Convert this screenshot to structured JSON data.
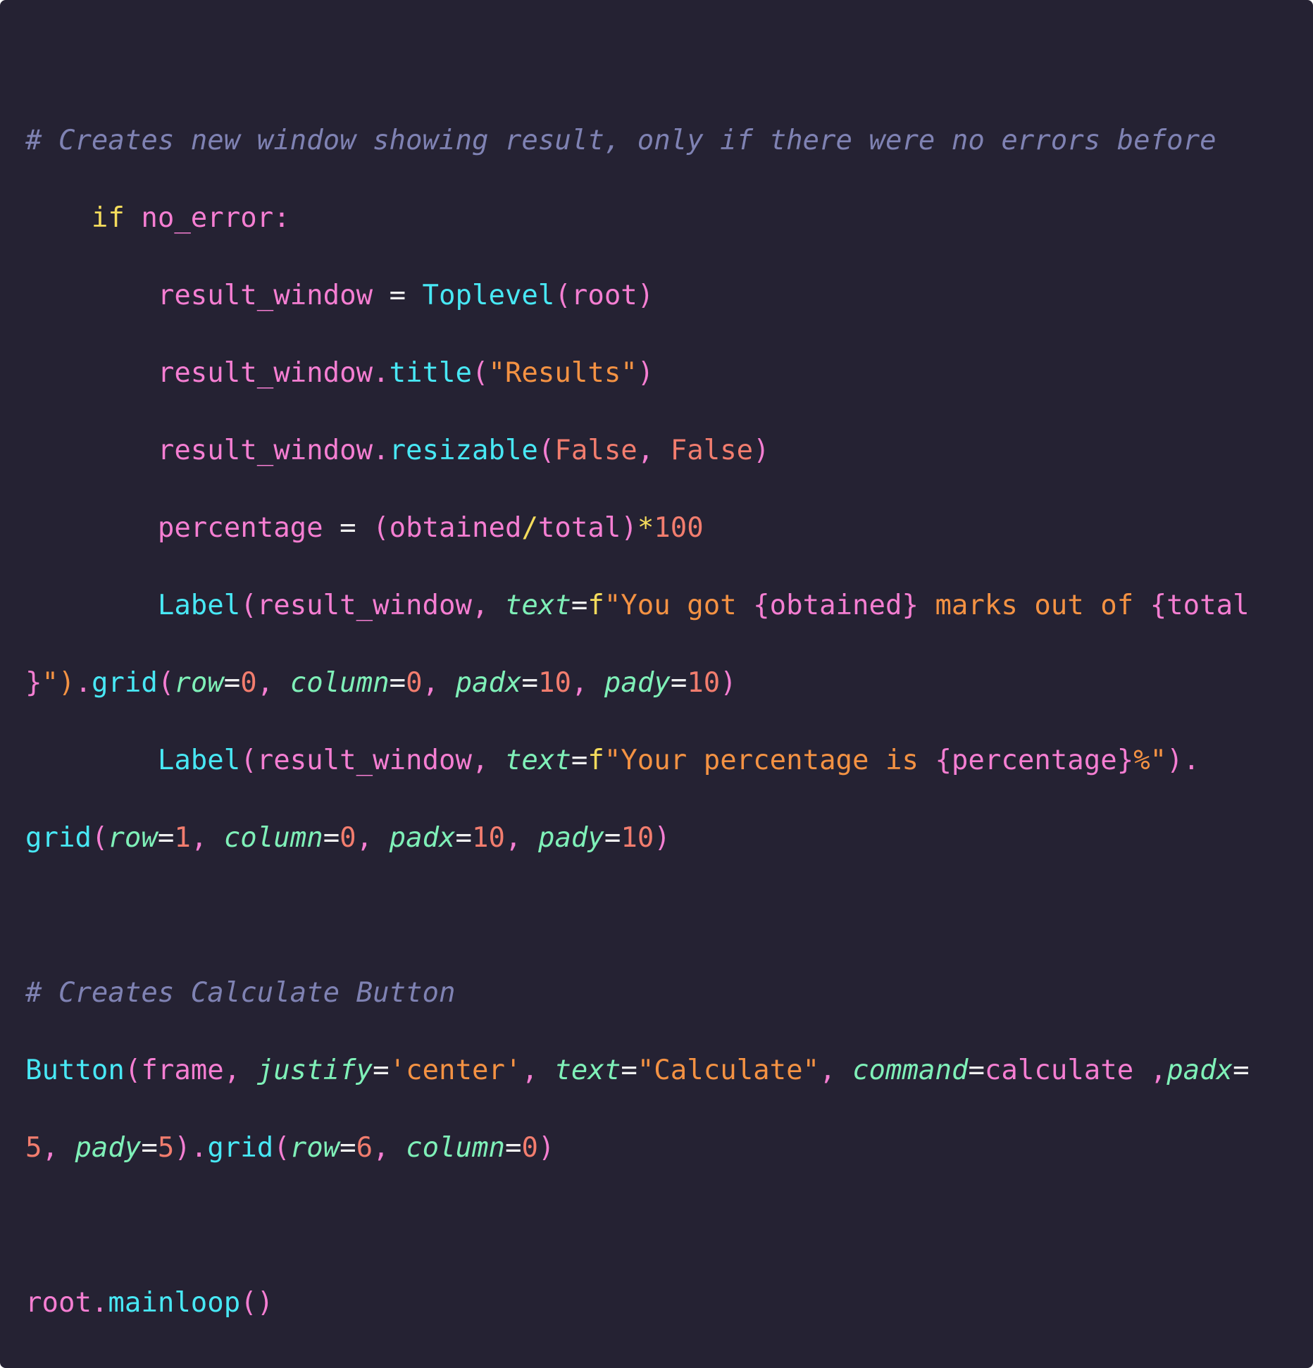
{
  "theme": {
    "background": "#252233",
    "colors": {
      "comment": "#7f82b3",
      "keyword": "#f5dc5c",
      "variable": "#f57ed2",
      "function": "#48e8f5",
      "string": "#f49243",
      "number": "#f27d6e",
      "param": "#7ff0b8",
      "operator": "#f0f0f0",
      "punct": "#f57ed2",
      "fstring_prefix": "#f5dc5c"
    }
  },
  "code_lines": [
    [
      {
        "t": "# Creates new window showing result, only if there were no errors before",
        "c": "comment",
        "i": true
      }
    ],
    [
      {
        "t": "    "
      },
      {
        "t": "if",
        "c": "keyword"
      },
      {
        "t": " no_error:",
        "c": "variable"
      }
    ],
    [
      {
        "t": "        "
      },
      {
        "t": "result_window",
        "c": "variable"
      },
      {
        "t": " = ",
        "c": "operator"
      },
      {
        "t": "Toplevel",
        "c": "function"
      },
      {
        "t": "(root)",
        "c": "variable"
      }
    ],
    [
      {
        "t": "        "
      },
      {
        "t": "result_window.",
        "c": "variable"
      },
      {
        "t": "title",
        "c": "function"
      },
      {
        "t": "(",
        "c": "punct"
      },
      {
        "t": "\"Results\"",
        "c": "string"
      },
      {
        "t": ")",
        "c": "punct"
      }
    ],
    [
      {
        "t": "        "
      },
      {
        "t": "result_window.",
        "c": "variable"
      },
      {
        "t": "resizable",
        "c": "function"
      },
      {
        "t": "(",
        "c": "punct"
      },
      {
        "t": "False",
        "c": "number"
      },
      {
        "t": ", ",
        "c": "punct"
      },
      {
        "t": "False",
        "c": "number"
      },
      {
        "t": ")",
        "c": "punct"
      }
    ],
    [
      {
        "t": "        "
      },
      {
        "t": "percentage",
        "c": "variable"
      },
      {
        "t": " = ",
        "c": "operator"
      },
      {
        "t": "(obtained",
        "c": "variable"
      },
      {
        "t": "/",
        "c": "keyword"
      },
      {
        "t": "total)",
        "c": "variable"
      },
      {
        "t": "*",
        "c": "keyword"
      },
      {
        "t": "100",
        "c": "number"
      }
    ],
    [
      {
        "t": "        "
      },
      {
        "t": "Label",
        "c": "function"
      },
      {
        "t": "(result_window, ",
        "c": "variable"
      },
      {
        "t": "text",
        "c": "param",
        "i": true
      },
      {
        "t": "=",
        "c": "operator"
      },
      {
        "t": "f",
        "c": "fstring_prefix"
      },
      {
        "t": "\"You got ",
        "c": "string"
      },
      {
        "t": "{obtained}",
        "c": "variable"
      },
      {
        "t": " marks out of ",
        "c": "string"
      },
      {
        "t": "{total",
        "c": "variable"
      }
    ],
    [
      {
        "t": "}",
        "c": "variable"
      },
      {
        "t": "\")",
        "c": "string"
      },
      {
        "t": ".",
        "c": "punct"
      },
      {
        "t": "grid",
        "c": "function"
      },
      {
        "t": "(",
        "c": "punct"
      },
      {
        "t": "row",
        "c": "param",
        "i": true
      },
      {
        "t": "=",
        "c": "operator"
      },
      {
        "t": "0",
        "c": "number"
      },
      {
        "t": ", ",
        "c": "punct"
      },
      {
        "t": "column",
        "c": "param",
        "i": true
      },
      {
        "t": "=",
        "c": "operator"
      },
      {
        "t": "0",
        "c": "number"
      },
      {
        "t": ", ",
        "c": "punct"
      },
      {
        "t": "padx",
        "c": "param",
        "i": true
      },
      {
        "t": "=",
        "c": "operator"
      },
      {
        "t": "10",
        "c": "number"
      },
      {
        "t": ", ",
        "c": "punct"
      },
      {
        "t": "pady",
        "c": "param",
        "i": true
      },
      {
        "t": "=",
        "c": "operator"
      },
      {
        "t": "10",
        "c": "number"
      },
      {
        "t": ")",
        "c": "punct"
      }
    ],
    [
      {
        "t": "        "
      },
      {
        "t": "Label",
        "c": "function"
      },
      {
        "t": "(result_window, ",
        "c": "variable"
      },
      {
        "t": "text",
        "c": "param",
        "i": true
      },
      {
        "t": "=",
        "c": "operator"
      },
      {
        "t": "f",
        "c": "fstring_prefix"
      },
      {
        "t": "\"Your percentage is ",
        "c": "string"
      },
      {
        "t": "{percentage}",
        "c": "variable"
      },
      {
        "t": "%\"",
        "c": "string"
      },
      {
        "t": ").",
        "c": "punct"
      }
    ],
    [
      {
        "t": "grid",
        "c": "function"
      },
      {
        "t": "(",
        "c": "punct"
      },
      {
        "t": "row",
        "c": "param",
        "i": true
      },
      {
        "t": "=",
        "c": "operator"
      },
      {
        "t": "1",
        "c": "number"
      },
      {
        "t": ", ",
        "c": "punct"
      },
      {
        "t": "column",
        "c": "param",
        "i": true
      },
      {
        "t": "=",
        "c": "operator"
      },
      {
        "t": "0",
        "c": "number"
      },
      {
        "t": ", ",
        "c": "punct"
      },
      {
        "t": "padx",
        "c": "param",
        "i": true
      },
      {
        "t": "=",
        "c": "operator"
      },
      {
        "t": "10",
        "c": "number"
      },
      {
        "t": ", ",
        "c": "punct"
      },
      {
        "t": "pady",
        "c": "param",
        "i": true
      },
      {
        "t": "=",
        "c": "operator"
      },
      {
        "t": "10",
        "c": "number"
      },
      {
        "t": ")",
        "c": "punct"
      }
    ],
    [],
    [
      {
        "t": "# Creates Calculate Button",
        "c": "comment",
        "i": true
      }
    ],
    [
      {
        "t": "Button",
        "c": "function"
      },
      {
        "t": "(frame, ",
        "c": "variable"
      },
      {
        "t": "justify",
        "c": "param",
        "i": true
      },
      {
        "t": "=",
        "c": "operator"
      },
      {
        "t": "'center'",
        "c": "string"
      },
      {
        "t": ", ",
        "c": "punct"
      },
      {
        "t": "text",
        "c": "param",
        "i": true
      },
      {
        "t": "=",
        "c": "operator"
      },
      {
        "t": "\"Calculate\"",
        "c": "string"
      },
      {
        "t": ", ",
        "c": "punct"
      },
      {
        "t": "command",
        "c": "param",
        "i": true
      },
      {
        "t": "=",
        "c": "operator"
      },
      {
        "t": "calculate ,",
        "c": "variable"
      },
      {
        "t": "padx",
        "c": "param",
        "i": true
      },
      {
        "t": "=",
        "c": "operator"
      }
    ],
    [
      {
        "t": "5",
        "c": "number"
      },
      {
        "t": ", ",
        "c": "punct"
      },
      {
        "t": "pady",
        "c": "param",
        "i": true
      },
      {
        "t": "=",
        "c": "operator"
      },
      {
        "t": "5",
        "c": "number"
      },
      {
        "t": ")",
        "c": "punct"
      },
      {
        "t": ".",
        "c": "punct"
      },
      {
        "t": "grid",
        "c": "function"
      },
      {
        "t": "(",
        "c": "punct"
      },
      {
        "t": "row",
        "c": "param",
        "i": true
      },
      {
        "t": "=",
        "c": "operator"
      },
      {
        "t": "6",
        "c": "number"
      },
      {
        "t": ", ",
        "c": "punct"
      },
      {
        "t": "column",
        "c": "param",
        "i": true
      },
      {
        "t": "=",
        "c": "operator"
      },
      {
        "t": "0",
        "c": "number"
      },
      {
        "t": ")",
        "c": "punct"
      }
    ],
    [],
    [
      {
        "t": "root.",
        "c": "variable"
      },
      {
        "t": "mainloop",
        "c": "function"
      },
      {
        "t": "()",
        "c": "punct"
      }
    ]
  ]
}
